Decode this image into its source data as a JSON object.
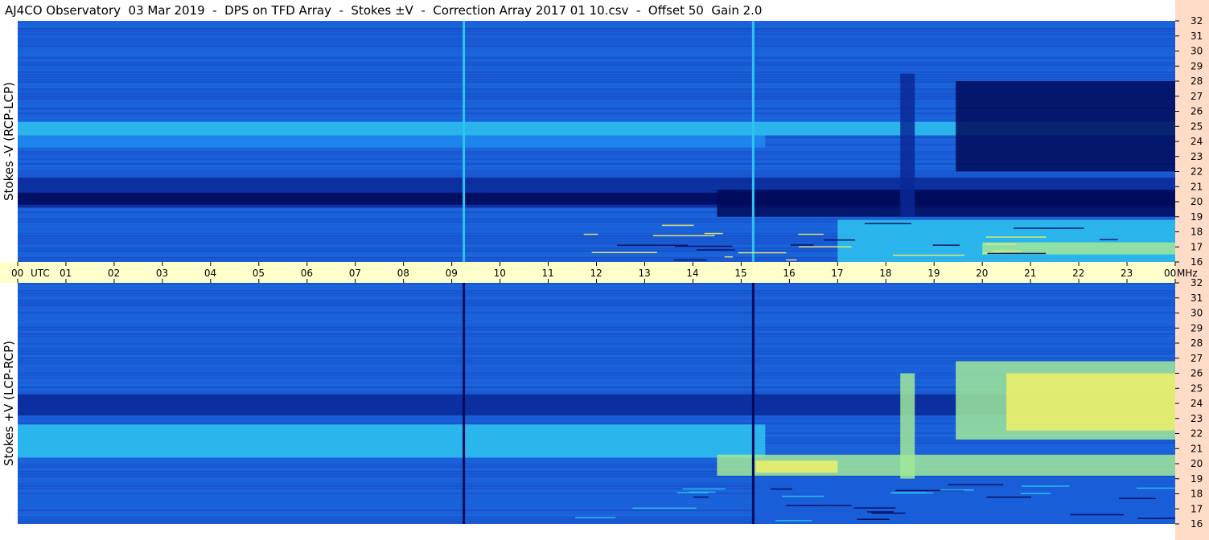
{
  "title": "AJ4CO Observatory  03 Mar 2019  -  DPS on TFD Array  -  Stokes ±V  -  Correction Array 2017 01 10.csv  -  Offset 50  Gain 2.0",
  "colors": {
    "time_band": "#ffffcc",
    "freq_band": "#ffdcc8",
    "deep": "#000a5a",
    "dark": "#0a2896",
    "base": "#1a5ed8",
    "mid": "#1e8cf0",
    "cyan": "#2ec4f0",
    "green": "#a0e89a",
    "yellow": "#eef06a",
    "orange": "#f08a28"
  },
  "chart_data": [
    {
      "type": "heatmap",
      "panel": "top",
      "ylabel": "Stokes -V (RCP-LCP)",
      "y_unit": "MHz",
      "x_unit": "UTC",
      "xlim": [
        0,
        24
      ],
      "ylim": [
        16,
        32
      ],
      "x_ticks": [
        "00",
        "01",
        "02",
        "03",
        "04",
        "05",
        "06",
        "07",
        "08",
        "09",
        "10",
        "11",
        "12",
        "13",
        "14",
        "15",
        "16",
        "17",
        "18",
        "19",
        "20",
        "21",
        "22",
        "23",
        "00"
      ],
      "y_ticks": [
        "16",
        "17",
        "18",
        "19",
        "20",
        "21",
        "22",
        "23",
        "24",
        "25",
        "26",
        "27",
        "28",
        "29",
        "30",
        "31",
        "32"
      ],
      "features": [
        {
          "type": "band",
          "x": [
            0,
            24
          ],
          "y": [
            24.4,
            25.3
          ],
          "level": "cyan"
        },
        {
          "type": "band",
          "x": [
            0,
            15.5
          ],
          "y": [
            23.6,
            24.4
          ],
          "level": "mid"
        },
        {
          "type": "band",
          "x": [
            0,
            24
          ],
          "y": [
            19.6,
            21.6
          ],
          "level": "dark"
        },
        {
          "type": "band",
          "x": [
            0,
            24
          ],
          "y": [
            19.8,
            20.6
          ],
          "level": "deep"
        },
        {
          "type": "band",
          "x": [
            14.5,
            24
          ],
          "y": [
            19.0,
            20.8
          ],
          "level": "deep"
        },
        {
          "type": "band",
          "x": [
            19.45,
            24
          ],
          "y": [
            22.0,
            28.0
          ],
          "level": "deep"
        },
        {
          "type": "band",
          "x": [
            18.3,
            18.6
          ],
          "y": [
            19.0,
            28.5
          ],
          "level": "dark"
        },
        {
          "type": "band",
          "x": [
            17.0,
            24
          ],
          "y": [
            16.0,
            18.8
          ],
          "level": "cyan"
        },
        {
          "type": "band",
          "x": [
            20.0,
            24
          ],
          "y": [
            16.5,
            17.3
          ],
          "level": "green"
        },
        {
          "type": "vline",
          "x": 9.25,
          "level": "cyan"
        },
        {
          "type": "vline",
          "x": 15.25,
          "level": "cyan"
        }
      ]
    },
    {
      "type": "heatmap",
      "panel": "bottom",
      "ylabel": "Stokes +V (LCP-RCP)",
      "y_unit": "MHz",
      "x_unit": "UTC",
      "xlim": [
        0,
        24
      ],
      "ylim": [
        16,
        32
      ],
      "y_ticks": [
        "16",
        "17",
        "18",
        "19",
        "20",
        "21",
        "22",
        "23",
        "24",
        "25",
        "26",
        "27",
        "28",
        "29",
        "30",
        "31",
        "32"
      ],
      "features": [
        {
          "type": "band",
          "x": [
            0,
            24
          ],
          "y": [
            23.2,
            24.6
          ],
          "level": "dark"
        },
        {
          "type": "band",
          "x": [
            0,
            15.5
          ],
          "y": [
            20.4,
            22.6
          ],
          "level": "cyan"
        },
        {
          "type": "band",
          "x": [
            14.5,
            24
          ],
          "y": [
            19.2,
            20.6
          ],
          "level": "green"
        },
        {
          "type": "band",
          "x": [
            15.3,
            17.0
          ],
          "y": [
            19.4,
            20.2
          ],
          "level": "yellow"
        },
        {
          "type": "band",
          "x": [
            19.45,
            24
          ],
          "y": [
            21.6,
            26.8
          ],
          "level": "green"
        },
        {
          "type": "band",
          "x": [
            20.5,
            24
          ],
          "y": [
            22.2,
            26.0
          ],
          "level": "yellow"
        },
        {
          "type": "band",
          "x": [
            18.3,
            18.6
          ],
          "y": [
            19.0,
            26.0
          ],
          "level": "green"
        },
        {
          "type": "band",
          "x": [
            15.3,
            24
          ],
          "y": [
            16.0,
            19.0
          ],
          "level": "base"
        },
        {
          "type": "vline",
          "x": 9.25,
          "level": "deep"
        },
        {
          "type": "vline",
          "x": 15.25,
          "level": "deep"
        }
      ]
    }
  ]
}
